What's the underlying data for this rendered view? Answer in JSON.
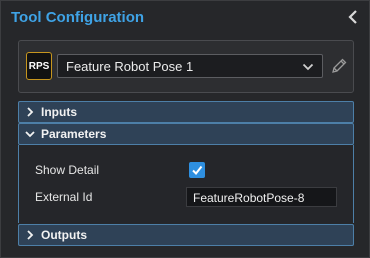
{
  "panel": {
    "title": "Tool Configuration"
  },
  "tool": {
    "badge": "RPS",
    "selected": "Feature Robot Pose 1"
  },
  "sections": {
    "inputs": {
      "label": "Inputs",
      "expanded": false
    },
    "parameters": {
      "label": "Parameters",
      "expanded": true
    },
    "outputs": {
      "label": "Outputs",
      "expanded": false
    }
  },
  "parameters": {
    "show_detail_label": "Show Detail",
    "show_detail_checked": true,
    "external_id_label": "External Id",
    "external_id_value": "FeatureRobotPose-8"
  },
  "colors": {
    "title": "#3fa3e6",
    "accent": "#2e8fe0",
    "badge_border": "#c7961e",
    "section_header": "#2f4257"
  },
  "icons": {
    "collapse": "chevron-left-icon",
    "dropdown": "chevron-down-icon",
    "edit": "pencil-icon",
    "collapsed_section": "chevron-right-icon",
    "expanded_section": "chevron-down-icon",
    "check": "check-icon"
  }
}
